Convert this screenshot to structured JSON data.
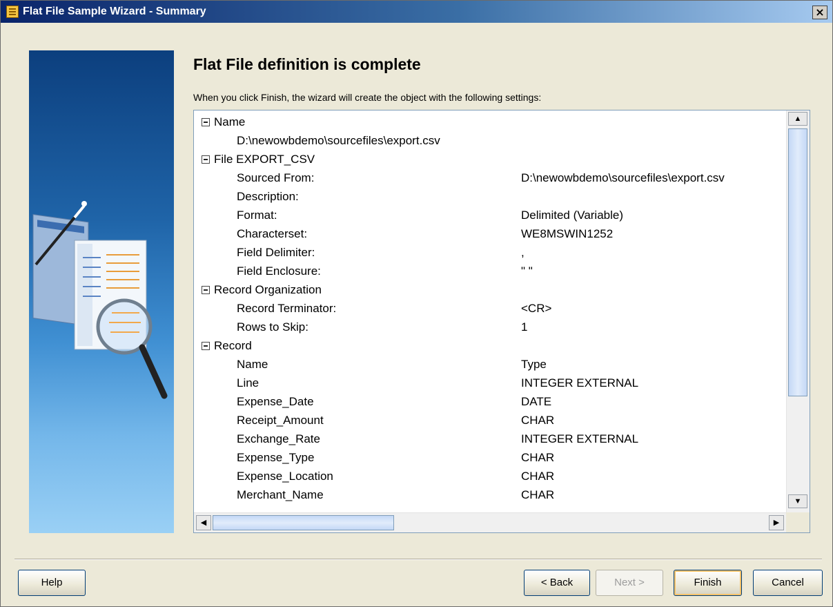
{
  "window": {
    "title": "Flat File Sample Wizard - Summary",
    "close_glyph": "×"
  },
  "page": {
    "heading": "Flat File definition is complete",
    "intro": "When you click Finish, the wizard will create the object with the following settings:"
  },
  "tree": {
    "groups": [
      {
        "label": "Name",
        "rows": [
          {
            "label": "D:\\newowbdemo\\sourcefiles\\export.csv",
            "value": ""
          }
        ]
      },
      {
        "label": "File EXPORT_CSV",
        "rows": [
          {
            "label": "Sourced From:",
            "value": "D:\\newowbdemo\\sourcefiles\\export.csv"
          },
          {
            "label": "Description:",
            "value": ""
          },
          {
            "label": "Format:",
            "value": "Delimited (Variable)"
          },
          {
            "label": "Characterset:",
            "value": "WE8MSWIN1252"
          },
          {
            "label": "Field Delimiter:",
            "value": ","
          },
          {
            "label": "Field Enclosure:",
            "value": "\" \""
          }
        ]
      },
      {
        "label": "Record Organization",
        "rows": [
          {
            "label": "Record Terminator:",
            "value": "<CR>"
          },
          {
            "label": "Rows to Skip:",
            "value": "1"
          }
        ]
      },
      {
        "label": "Record",
        "rows": [
          {
            "label": "Name",
            "value": "Type"
          },
          {
            "label": "Line",
            "value": "INTEGER EXTERNAL"
          },
          {
            "label": "Expense_Date",
            "value": "DATE"
          },
          {
            "label": "Receipt_Amount",
            "value": "CHAR"
          },
          {
            "label": "Exchange_Rate",
            "value": "INTEGER EXTERNAL"
          },
          {
            "label": "Expense_Type",
            "value": "CHAR"
          },
          {
            "label": "Expense_Location",
            "value": "CHAR"
          },
          {
            "label": "Merchant_Name",
            "value": "CHAR"
          }
        ]
      }
    ]
  },
  "scrollbars": {
    "up_glyph": "▲",
    "down_glyph": "▼",
    "left_glyph": "◀",
    "right_glyph": "▶",
    "vertical_position": 0.0,
    "horizontal_position": 0.0
  },
  "buttons": {
    "help": "Help",
    "back": "< Back",
    "next": "Next >",
    "finish": "Finish",
    "cancel": "Cancel"
  }
}
